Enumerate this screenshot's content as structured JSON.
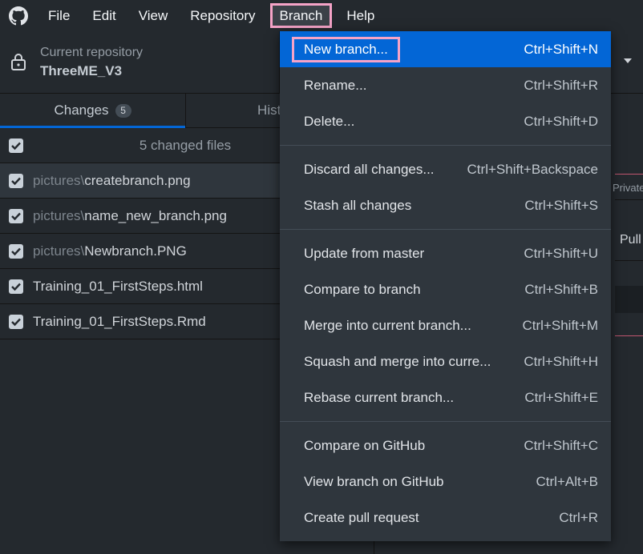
{
  "menubar": {
    "items": [
      "File",
      "Edit",
      "View",
      "Repository",
      "Branch",
      "Help"
    ]
  },
  "toolbar": {
    "repo_caption": "Current repository",
    "repo_name": "ThreeME_V3"
  },
  "tabs": {
    "changes_label": "Changes",
    "changes_count": "5",
    "history_label": "History"
  },
  "files": {
    "summary": "5 changed files",
    "rows": [
      {
        "dir": "pictures\\",
        "name": "createbranch.png"
      },
      {
        "dir": "pictures\\",
        "name": "name_new_branch.png"
      },
      {
        "dir": "pictures\\",
        "name": "Newbranch.PNG"
      },
      {
        "dir": "",
        "name": "Training_01_FirstSteps.html"
      },
      {
        "dir": "",
        "name": "Training_01_FirstSteps.Rmd"
      }
    ]
  },
  "right_pane": {
    "private_label": "Private",
    "pull_label": "Pull"
  },
  "branch_menu": {
    "items": [
      {
        "label": "New branch...",
        "shortcut": "Ctrl+Shift+N"
      },
      {
        "label": "Rename...",
        "shortcut": "Ctrl+Shift+R"
      },
      {
        "label": "Delete...",
        "shortcut": "Ctrl+Shift+D"
      },
      {
        "label": "Discard all changes...",
        "shortcut": "Ctrl+Shift+Backspace"
      },
      {
        "label": "Stash all changes",
        "shortcut": "Ctrl+Shift+S"
      },
      {
        "label": "Update from master",
        "shortcut": "Ctrl+Shift+U"
      },
      {
        "label": "Compare to branch",
        "shortcut": "Ctrl+Shift+B"
      },
      {
        "label": "Merge into current branch...",
        "shortcut": "Ctrl+Shift+M"
      },
      {
        "label": "Squash and merge into curre...",
        "shortcut": "Ctrl+Shift+H"
      },
      {
        "label": "Rebase current branch...",
        "shortcut": "Ctrl+Shift+E"
      },
      {
        "label": "Compare on GitHub",
        "shortcut": "Ctrl+Shift+C"
      },
      {
        "label": "View branch on GitHub",
        "shortcut": "Ctrl+Alt+B"
      },
      {
        "label": "Create pull request",
        "shortcut": "Ctrl+R"
      }
    ]
  },
  "colors": {
    "background": "#24292e",
    "menu_background": "#2f363d",
    "highlight": "#0366d6",
    "annotation_pink": "#f5a3c7"
  }
}
